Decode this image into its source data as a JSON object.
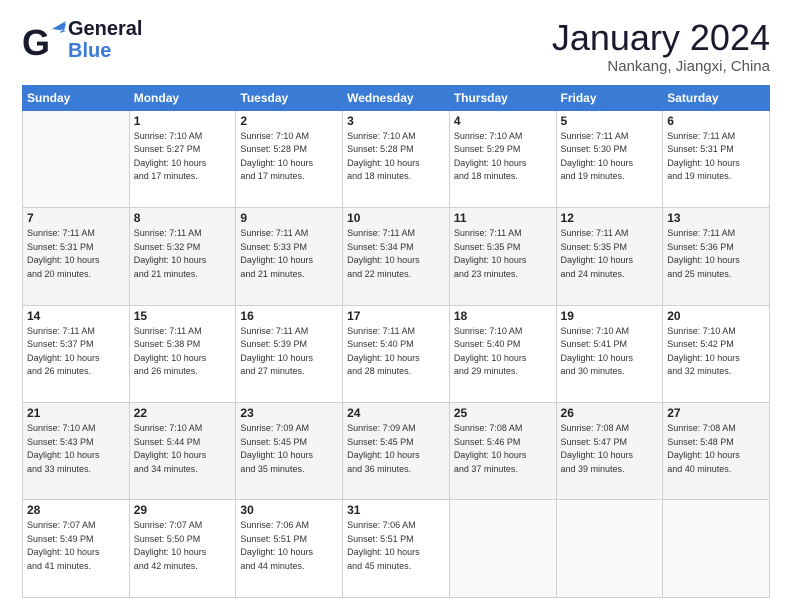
{
  "header": {
    "logo_general": "General",
    "logo_blue": "Blue",
    "month_title": "January 2024",
    "location": "Nankang, Jiangxi, China"
  },
  "days_of_week": [
    "Sunday",
    "Monday",
    "Tuesday",
    "Wednesday",
    "Thursday",
    "Friday",
    "Saturday"
  ],
  "weeks": [
    [
      {
        "day": "",
        "info": ""
      },
      {
        "day": "1",
        "info": "Sunrise: 7:10 AM\nSunset: 5:27 PM\nDaylight: 10 hours\nand 17 minutes."
      },
      {
        "day": "2",
        "info": "Sunrise: 7:10 AM\nSunset: 5:28 PM\nDaylight: 10 hours\nand 17 minutes."
      },
      {
        "day": "3",
        "info": "Sunrise: 7:10 AM\nSunset: 5:28 PM\nDaylight: 10 hours\nand 18 minutes."
      },
      {
        "day": "4",
        "info": "Sunrise: 7:10 AM\nSunset: 5:29 PM\nDaylight: 10 hours\nand 18 minutes."
      },
      {
        "day": "5",
        "info": "Sunrise: 7:11 AM\nSunset: 5:30 PM\nDaylight: 10 hours\nand 19 minutes."
      },
      {
        "day": "6",
        "info": "Sunrise: 7:11 AM\nSunset: 5:31 PM\nDaylight: 10 hours\nand 19 minutes."
      }
    ],
    [
      {
        "day": "7",
        "info": "Sunrise: 7:11 AM\nSunset: 5:31 PM\nDaylight: 10 hours\nand 20 minutes."
      },
      {
        "day": "8",
        "info": "Sunrise: 7:11 AM\nSunset: 5:32 PM\nDaylight: 10 hours\nand 21 minutes."
      },
      {
        "day": "9",
        "info": "Sunrise: 7:11 AM\nSunset: 5:33 PM\nDaylight: 10 hours\nand 21 minutes."
      },
      {
        "day": "10",
        "info": "Sunrise: 7:11 AM\nSunset: 5:34 PM\nDaylight: 10 hours\nand 22 minutes."
      },
      {
        "day": "11",
        "info": "Sunrise: 7:11 AM\nSunset: 5:35 PM\nDaylight: 10 hours\nand 23 minutes."
      },
      {
        "day": "12",
        "info": "Sunrise: 7:11 AM\nSunset: 5:35 PM\nDaylight: 10 hours\nand 24 minutes."
      },
      {
        "day": "13",
        "info": "Sunrise: 7:11 AM\nSunset: 5:36 PM\nDaylight: 10 hours\nand 25 minutes."
      }
    ],
    [
      {
        "day": "14",
        "info": "Sunrise: 7:11 AM\nSunset: 5:37 PM\nDaylight: 10 hours\nand 26 minutes."
      },
      {
        "day": "15",
        "info": "Sunrise: 7:11 AM\nSunset: 5:38 PM\nDaylight: 10 hours\nand 26 minutes."
      },
      {
        "day": "16",
        "info": "Sunrise: 7:11 AM\nSunset: 5:39 PM\nDaylight: 10 hours\nand 27 minutes."
      },
      {
        "day": "17",
        "info": "Sunrise: 7:11 AM\nSunset: 5:40 PM\nDaylight: 10 hours\nand 28 minutes."
      },
      {
        "day": "18",
        "info": "Sunrise: 7:10 AM\nSunset: 5:40 PM\nDaylight: 10 hours\nand 29 minutes."
      },
      {
        "day": "19",
        "info": "Sunrise: 7:10 AM\nSunset: 5:41 PM\nDaylight: 10 hours\nand 30 minutes."
      },
      {
        "day": "20",
        "info": "Sunrise: 7:10 AM\nSunset: 5:42 PM\nDaylight: 10 hours\nand 32 minutes."
      }
    ],
    [
      {
        "day": "21",
        "info": "Sunrise: 7:10 AM\nSunset: 5:43 PM\nDaylight: 10 hours\nand 33 minutes."
      },
      {
        "day": "22",
        "info": "Sunrise: 7:10 AM\nSunset: 5:44 PM\nDaylight: 10 hours\nand 34 minutes."
      },
      {
        "day": "23",
        "info": "Sunrise: 7:09 AM\nSunset: 5:45 PM\nDaylight: 10 hours\nand 35 minutes."
      },
      {
        "day": "24",
        "info": "Sunrise: 7:09 AM\nSunset: 5:45 PM\nDaylight: 10 hours\nand 36 minutes."
      },
      {
        "day": "25",
        "info": "Sunrise: 7:08 AM\nSunset: 5:46 PM\nDaylight: 10 hours\nand 37 minutes."
      },
      {
        "day": "26",
        "info": "Sunrise: 7:08 AM\nSunset: 5:47 PM\nDaylight: 10 hours\nand 39 minutes."
      },
      {
        "day": "27",
        "info": "Sunrise: 7:08 AM\nSunset: 5:48 PM\nDaylight: 10 hours\nand 40 minutes."
      }
    ],
    [
      {
        "day": "28",
        "info": "Sunrise: 7:07 AM\nSunset: 5:49 PM\nDaylight: 10 hours\nand 41 minutes."
      },
      {
        "day": "29",
        "info": "Sunrise: 7:07 AM\nSunset: 5:50 PM\nDaylight: 10 hours\nand 42 minutes."
      },
      {
        "day": "30",
        "info": "Sunrise: 7:06 AM\nSunset: 5:51 PM\nDaylight: 10 hours\nand 44 minutes."
      },
      {
        "day": "31",
        "info": "Sunrise: 7:06 AM\nSunset: 5:51 PM\nDaylight: 10 hours\nand 45 minutes."
      },
      {
        "day": "",
        "info": ""
      },
      {
        "day": "",
        "info": ""
      },
      {
        "day": "",
        "info": ""
      }
    ]
  ]
}
